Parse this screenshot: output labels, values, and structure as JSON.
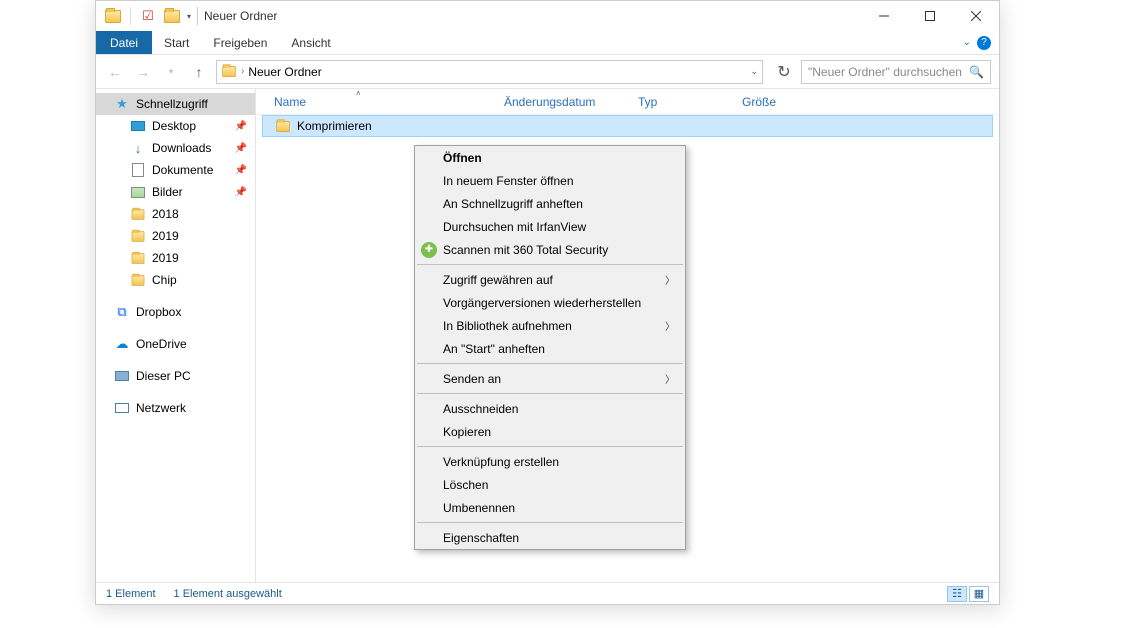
{
  "window": {
    "title": "Neuer Ordner"
  },
  "ribbon": {
    "datei": "Datei",
    "tabs": [
      "Start",
      "Freigeben",
      "Ansicht"
    ]
  },
  "breadcrumb": {
    "location": "Neuer Ordner"
  },
  "search": {
    "placeholder": "\"Neuer Ordner\" durchsuchen"
  },
  "columns": {
    "name": "Name",
    "date": "Änderungsdatum",
    "type": "Typ",
    "size": "Größe"
  },
  "rows": [
    {
      "name": "Komprimieren"
    }
  ],
  "sidebar": {
    "quick": "Schnellzugriff",
    "desktop": "Desktop",
    "downloads": "Downloads",
    "documents": "Dokumente",
    "pictures": "Bilder",
    "folders": [
      "2018",
      "2019",
      "2019",
      "Chip"
    ],
    "dropbox": "Dropbox",
    "onedrive": "OneDrive",
    "thispc": "Dieser PC",
    "network": "Netzwerk"
  },
  "context": {
    "open": "Öffnen",
    "newwin": "In neuem Fenster öffnen",
    "pinquick": "An Schnellzugriff anheften",
    "irfan": "Durchsuchen mit IrfanView",
    "scan": "Scannen mit 360 Total Security",
    "grant": "Zugriff gewähren auf",
    "prev": "Vorgängerversionen wiederherstellen",
    "lib": "In Bibliothek aufnehmen",
    "pinstart": "An \"Start\" anheften",
    "sendto": "Senden an",
    "cut": "Ausschneiden",
    "copy": "Kopieren",
    "shortcut": "Verknüpfung erstellen",
    "delete": "Löschen",
    "rename": "Umbenennen",
    "props": "Eigenschaften"
  },
  "status": {
    "count": "1 Element",
    "selected": "1 Element ausgewählt"
  }
}
